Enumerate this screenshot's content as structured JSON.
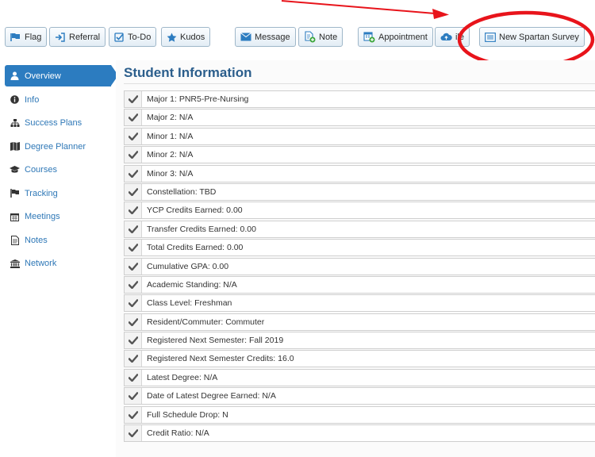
{
  "toolbar": {
    "flag": "Flag",
    "referral": "Referral",
    "todo": "To-Do",
    "kudos": "Kudos",
    "message": "Message",
    "note": "Note",
    "appointment": "Appointment",
    "file": "ile",
    "survey": "New Spartan Survey"
  },
  "sidebar": {
    "items": [
      {
        "label": "Overview",
        "icon": "user-icon"
      },
      {
        "label": "Info",
        "icon": "info-icon"
      },
      {
        "label": "Success Plans",
        "icon": "sitemap-icon"
      },
      {
        "label": "Degree Planner",
        "icon": "map-icon"
      },
      {
        "label": "Courses",
        "icon": "graduation-cap-icon"
      },
      {
        "label": "Tracking",
        "icon": "flag-icon"
      },
      {
        "label": "Meetings",
        "icon": "calendar-icon"
      },
      {
        "label": "Notes",
        "icon": "note-icon"
      },
      {
        "label": "Network",
        "icon": "institution-icon"
      }
    ]
  },
  "main": {
    "title": "Student Information",
    "rows": [
      "Major 1: PNR5-Pre-Nursing",
      "Major 2: N/A",
      "Minor 1: N/A",
      "Minor 2: N/A",
      "Minor 3: N/A",
      "Constellation: TBD",
      "YCP Credits Earned: 0.00",
      "Transfer Credits Earned: 0.00",
      "Total Credits Earned: 0.00",
      "Cumulative GPA: 0.00",
      "Academic Standing: N/A",
      "Class Level: Freshman",
      "Resident/Commuter: Commuter",
      "Registered Next Semester: Fall 2019",
      "Registered Next Semester Credits: 16.0",
      "Latest Degree: N/A",
      "Date of Latest Degree Earned: N/A",
      "Full Schedule Drop: N",
      "Credit Ratio: N/A"
    ]
  },
  "colors": {
    "accent": "#2c7cc0",
    "link": "#2f78b7",
    "annotation": "#e8141b"
  }
}
